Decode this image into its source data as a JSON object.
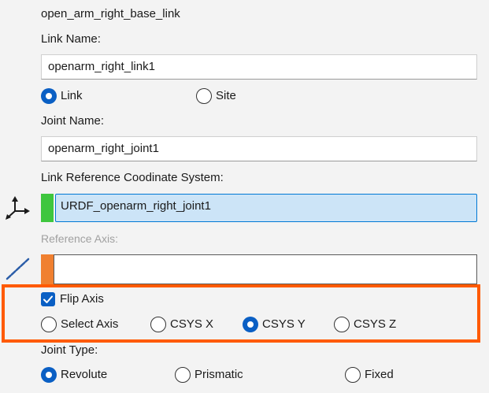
{
  "header": {
    "link_path": "open_arm_right_base_link"
  },
  "link_name": {
    "label": "Link Name:",
    "value": "openarm_right_link1"
  },
  "link_type": {
    "options": [
      {
        "label": "Link",
        "selected": true
      },
      {
        "label": "Site",
        "selected": false
      }
    ]
  },
  "joint_name": {
    "label": "Joint Name:",
    "value": "openarm_right_joint1"
  },
  "link_ref_csys": {
    "label": "Link Reference Coodinate System:",
    "value": "URDF_openarm_right_joint1",
    "indicator_color": "#3ec63e",
    "icon": "coordinate-system-icon"
  },
  "reference_axis": {
    "label": "Reference Axis:",
    "value": "",
    "indicator_color": "#f08030",
    "icon": "axis-line-icon"
  },
  "flip_axis": {
    "label": "Flip Axis",
    "checked": true
  },
  "axis_options": [
    {
      "label": "Select Axis",
      "selected": false
    },
    {
      "label": "CSYS X",
      "selected": false
    },
    {
      "label": "CSYS Y",
      "selected": true
    },
    {
      "label": "CSYS Z",
      "selected": false
    }
  ],
  "joint_type": {
    "label": "Joint Type:",
    "options": [
      {
        "label": "Revolute",
        "selected": true
      },
      {
        "label": "Prismatic",
        "selected": false
      },
      {
        "label": "Fixed",
        "selected": false
      }
    ]
  },
  "colors": {
    "accent": "#0a5fc4",
    "highlight": "#ff5a00",
    "selection": "#cce4f7"
  }
}
